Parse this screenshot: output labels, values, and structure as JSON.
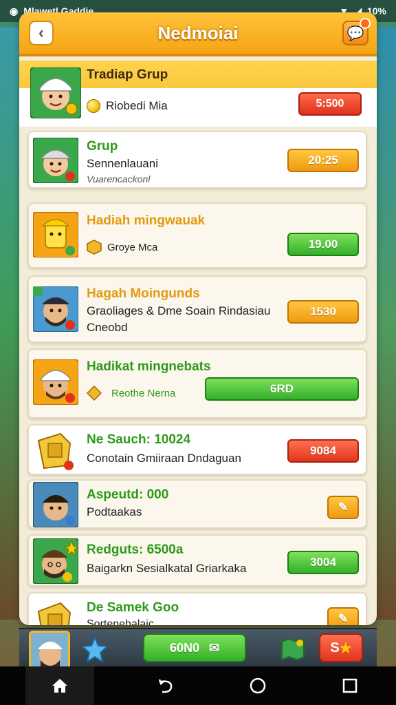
{
  "status_bar": {
    "carrier": "Mlawetl Gaddie",
    "battery": "10%"
  },
  "header": {
    "title": "Nedmoiai"
  },
  "group": {
    "title": "Tradiap Grup",
    "subtitle": "Riobedi Mia",
    "button": "5:500"
  },
  "rows": [
    {
      "title": "Grup",
      "line1": "Sennenlauani",
      "line2": "Vuarencackonl",
      "button": "20:25",
      "title_color": "#2f9a1a",
      "button_style": "orange"
    },
    {
      "title": "Hadiah mingwauak",
      "line1": "Groye Mca",
      "button": "19.00",
      "title_color": "#e39a10",
      "button_style": "green"
    },
    {
      "title": "Hagah Moingunds",
      "line1": "Graoliages & Dme Soain Rindasiau",
      "line2": "Cneobd",
      "button": "1530",
      "title_color": "#e39a10",
      "button_style": "orange"
    },
    {
      "title": "Hadikat mingnebats",
      "line1": "Reothe Nerna",
      "button": "6RD",
      "title_color": "#2f9a1a",
      "button_style": "green"
    },
    {
      "title": "Ne Sauch: 10024",
      "line1": "Conotain Gmiiraan Dndaguan",
      "button": "9084",
      "title_color": "#2f9a1a",
      "button_style": "red"
    },
    {
      "title": "Aspeutd: 000",
      "line1": "Podtaakas",
      "title_color": "#2f9a1a",
      "button_style": "orange-small"
    },
    {
      "title": "Redguts: 6500a",
      "line1": "Baigarkn  Sesialkatal Griarkaka",
      "button": "3004",
      "title_color": "#2f9a1a",
      "button_style": "green"
    },
    {
      "title": "De Samek Goo",
      "line1": "Sortenebalaic",
      "title_color": "#2f9a1a",
      "button_style": "orange-small"
    }
  ],
  "bottom_bar": {
    "send_label": "60N0",
    "shop_label": "S"
  },
  "colors": {
    "accent": "#f5a514",
    "panel": "#f3ecd9",
    "green": "#34b02a",
    "red": "#e0311c"
  }
}
